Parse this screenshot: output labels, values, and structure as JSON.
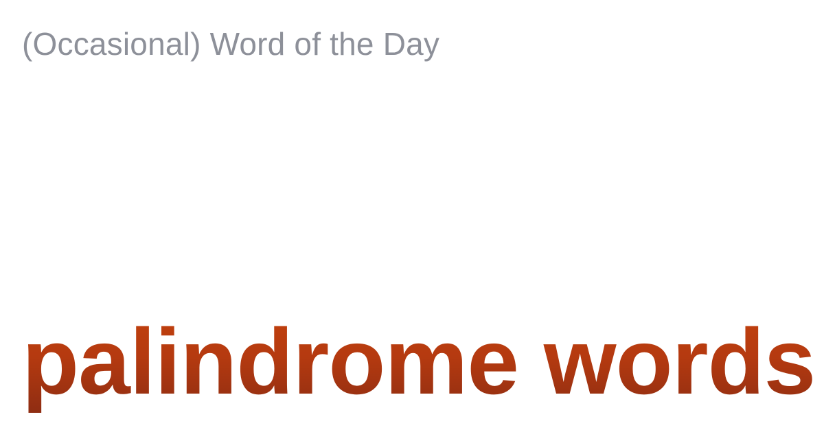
{
  "header": {
    "kicker": "(Occasional) Word of the Day"
  },
  "main": {
    "headline": "palindrome words"
  },
  "colors": {
    "kicker_text": "#8d9099",
    "headline_gradient_top": "#c2410c",
    "headline_gradient_bottom": "#8f2d12",
    "background": "#ffffff"
  }
}
